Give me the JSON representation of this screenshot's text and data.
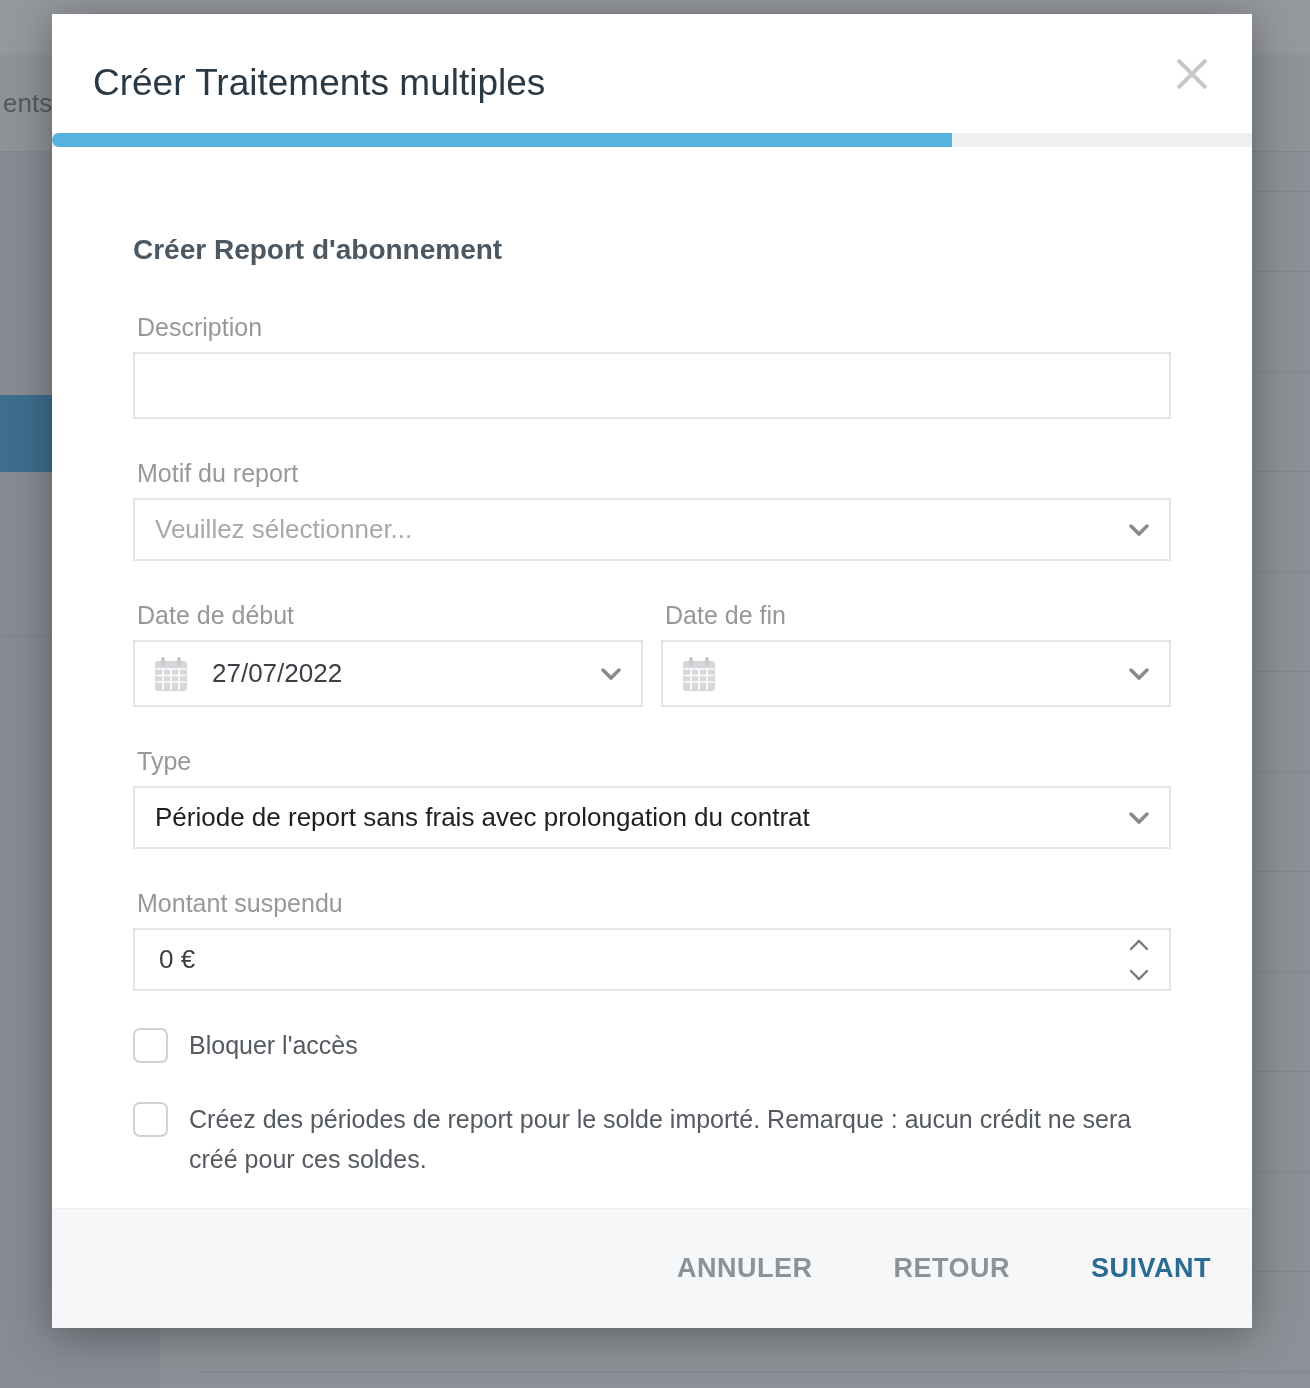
{
  "background": {
    "tab_label": "ents"
  },
  "dialog": {
    "title": "Créer Traitements multiples",
    "progress": {
      "level": 0.75
    }
  },
  "section_title": "Créer Report d'abonnement",
  "form_rows": [
    {
      "fields": [
        {
          "kind": "text",
          "label": "Description"
        }
      ]
    },
    {
      "fields": [
        {
          "kind": "select",
          "label": "Motif du report",
          "placeholder": "Veuillez sélectionner..."
        }
      ]
    },
    {
      "fields": [
        {
          "kind": "date",
          "label": "Date de début",
          "value": "27/07/2022"
        },
        {
          "kind": "date",
          "label": "Date de fin"
        }
      ]
    },
    {
      "fields": [
        {
          "kind": "select",
          "label": "Type",
          "value": "Période de report sans frais avec prolongation du contrat"
        }
      ]
    },
    {
      "fields": [
        {
          "kind": "number",
          "label": "Montant suspendu",
          "value": "0 €"
        }
      ]
    }
  ],
  "checkboxes": [
    {
      "label": "Bloquer l'accès",
      "checked": false
    },
    {
      "label": "Créez des périodes de report pour le solde importé. Remarque : aucun crédit ne sera créé pour ces soldes.",
      "checked": false
    }
  ],
  "buttons": [
    {
      "label": "ANNULER",
      "kind": "secondary"
    },
    {
      "label": "RETOUR",
      "kind": "secondary"
    },
    {
      "label": "SUIVANT",
      "kind": "primary"
    }
  ]
}
